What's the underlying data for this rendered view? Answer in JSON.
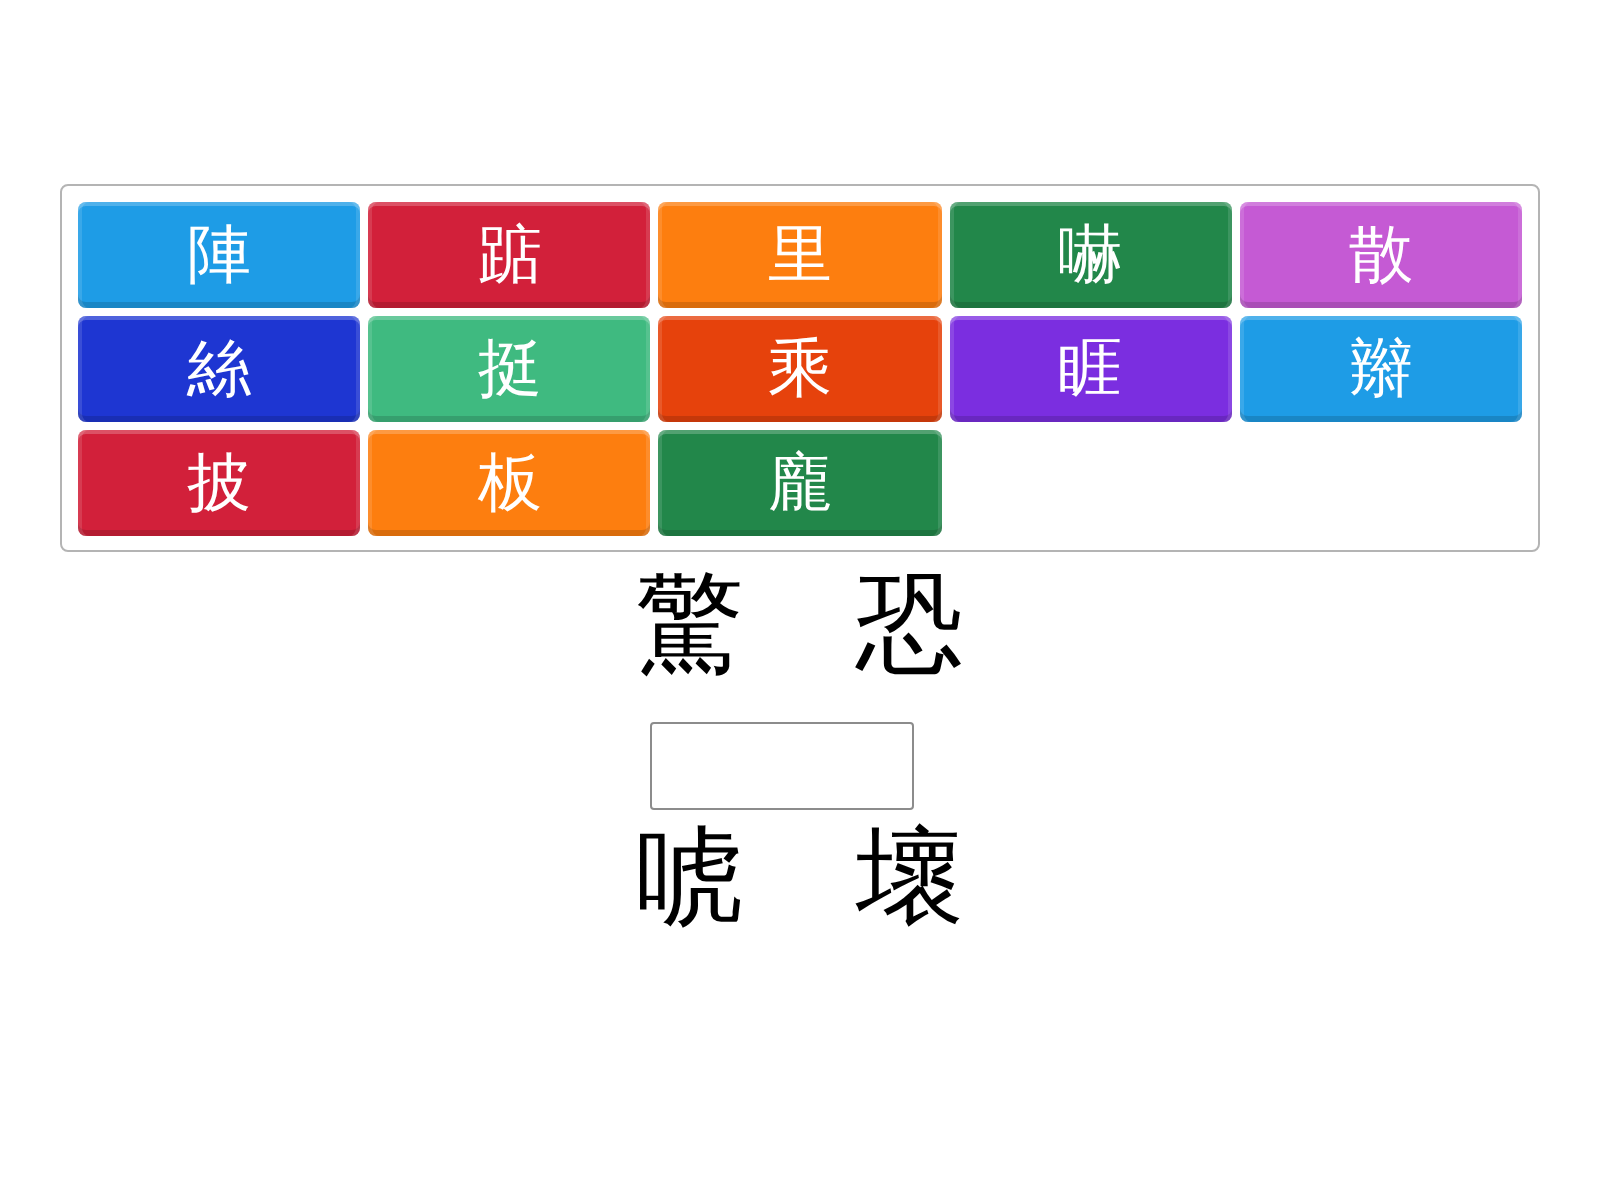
{
  "tiles": [
    {
      "text": "陣",
      "color": "#1e9ce6"
    },
    {
      "text": "踮",
      "color": "#d2203a"
    },
    {
      "text": "里",
      "color": "#fd7e0f"
    },
    {
      "text": "嚇",
      "color": "#22874a"
    },
    {
      "text": "散",
      "color": "#c55ad4"
    },
    {
      "text": "絲",
      "color": "#1e36d2"
    },
    {
      "text": "挺",
      "color": "#3fba80"
    },
    {
      "text": "乘",
      "color": "#e6420c"
    },
    {
      "text": "睚",
      "color": "#7b2ee0"
    },
    {
      "text": "辮",
      "color": "#1e9ce6"
    },
    {
      "text": "披",
      "color": "#d2203a"
    },
    {
      "text": "板",
      "color": "#fd7e0f"
    },
    {
      "text": "龐",
      "color": "#22874a"
    }
  ],
  "puzzle": {
    "top": [
      "驚",
      "恐"
    ],
    "bottom": [
      "唬",
      "壞"
    ]
  }
}
